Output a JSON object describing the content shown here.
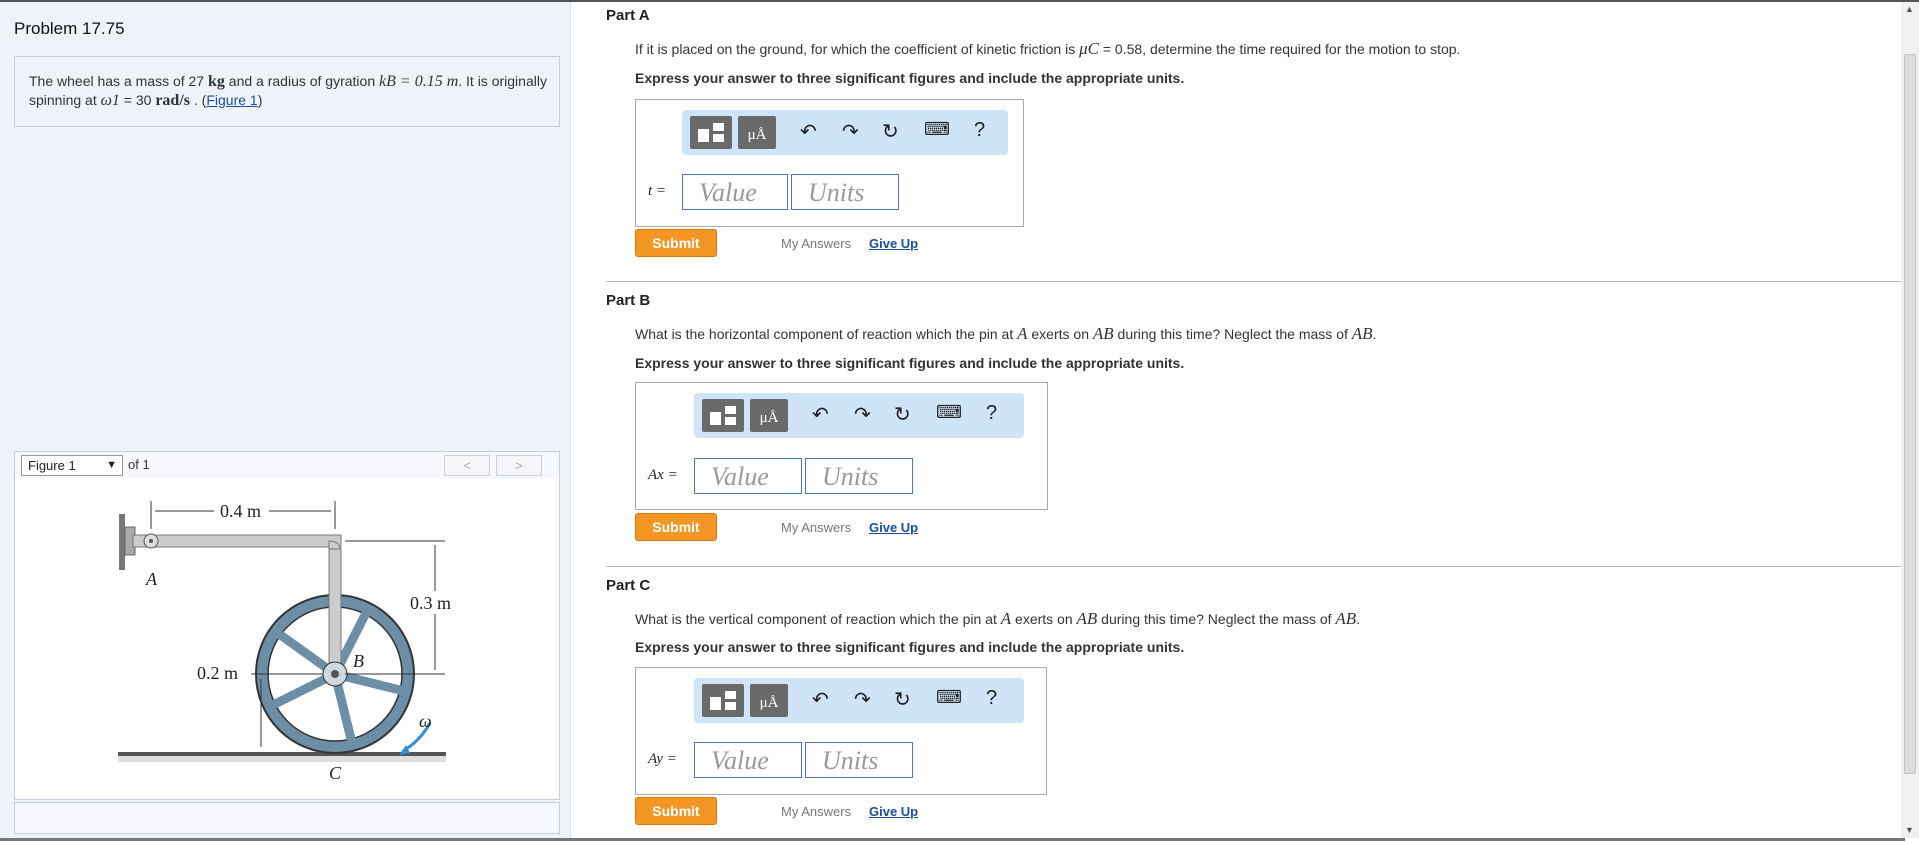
{
  "problem": {
    "title": "Problem 17.75",
    "text_before": "The wheel has a mass of 27 ",
    "mass_unit": "kg",
    "text_mid1": " and a radius of gyration ",
    "kB": "kB = 0.15 m",
    "text_mid2": ". It is originally spinning at ",
    "omega": "ω1",
    "omega_value": " = 30 ",
    "omega_unit": "rad/s",
    "text_end": " . (",
    "figure_link": "Figure 1",
    "close_paren": ")"
  },
  "figure": {
    "select_label": "Figure 1",
    "of_label": "of 1",
    "prev": "<",
    "next": ">",
    "labels": {
      "len_04": "0.4 m",
      "len_03": "0.3 m",
      "len_02": "0.2 m",
      "A": "A",
      "B": "B",
      "C": "C",
      "omega": "ω"
    }
  },
  "parts": [
    {
      "title": "Part A",
      "question_before": "If it is placed on the ground, for which the coefficient of kinetic friction is ",
      "question_sym": "μC",
      "question_after": " = 0.58, determine the time required for the motion to stop.",
      "instruction": "Express your answer to three significant figures and include the appropriate units.",
      "var": "t =",
      "value_placeholder": "Value",
      "units_placeholder": "Units",
      "submit": "Submit",
      "my_answers": "My Answers",
      "give_up": "Give Up"
    },
    {
      "title": "Part B",
      "question_before": "What is the horizontal component of reaction which the pin at ",
      "sym1": "A",
      "question_mid": " exerts on ",
      "sym2": "AB",
      "question_after": " during this time? Neglect the mass of ",
      "sym3": "AB",
      "question_end": ".",
      "instruction": "Express your answer to three significant figures and include the appropriate units.",
      "var": "Ax =",
      "value_placeholder": "Value",
      "units_placeholder": "Units",
      "submit": "Submit",
      "my_answers": "My Answers",
      "give_up": "Give Up"
    },
    {
      "title": "Part C",
      "question_before": "What is the vertical component of reaction which the pin at ",
      "sym1": "A",
      "question_mid": " exerts on ",
      "sym2": "AB",
      "question_after": " during this time? Neglect the mass of ",
      "sym3": "AB",
      "question_end": ".",
      "instruction": "Express your answer to three significant figures and include the appropriate units.",
      "var": "Ay =",
      "value_placeholder": "Value",
      "units_placeholder": "Units",
      "submit": "Submit",
      "my_answers": "My Answers",
      "give_up": "Give Up"
    }
  ],
  "toolbar": {
    "units_btn": "μÅ",
    "help": "?",
    "icons": [
      "templates-icon",
      "units-icon",
      "undo-icon",
      "redo-icon",
      "reset-icon",
      "keyboard-icon",
      "help-icon"
    ]
  },
  "colors": {
    "submit": "#f39624",
    "toolbar_bg": "#cfe4f7",
    "link": "#1a4ea1",
    "field_border": "#4a78c2"
  }
}
